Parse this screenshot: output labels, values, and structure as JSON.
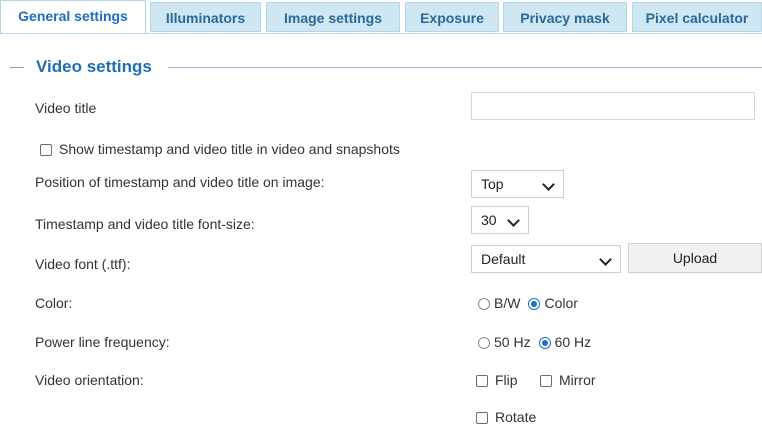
{
  "tabs": [
    {
      "label": "General settings",
      "active": true
    },
    {
      "label": "Illuminators",
      "active": false
    },
    {
      "label": "Image settings",
      "active": false
    },
    {
      "label": "Exposure",
      "active": false
    },
    {
      "label": "Privacy mask",
      "active": false
    },
    {
      "label": "Pixel calculator",
      "active": false
    }
  ],
  "section": {
    "title": "Video settings"
  },
  "fields": {
    "video_title": {
      "label": "Video title",
      "value": ""
    },
    "show_timestamp": {
      "label": "Show timestamp and video title in video and snapshots",
      "checked": false
    },
    "position": {
      "label": "Position of timestamp and video title on image:",
      "value": "Top"
    },
    "font_size": {
      "label": "Timestamp and video title font-size:",
      "value": "30"
    },
    "video_font": {
      "label": "Video font (.ttf):",
      "value": "Default",
      "upload_label": "Upload"
    },
    "color": {
      "label": "Color:",
      "options": [
        "B/W",
        "Color"
      ],
      "selected": "Color"
    },
    "power_line": {
      "label": "Power line frequency:",
      "options": [
        "50 Hz",
        "60 Hz"
      ],
      "selected": "60 Hz"
    },
    "orientation": {
      "label": "Video orientation:",
      "flip": "Flip",
      "mirror": "Mirror",
      "rotate": "Rotate"
    }
  },
  "colors": {
    "tab_bg": "#cfe6f3",
    "accent": "#1f6fb3",
    "radio_on": "#1d6fd0"
  }
}
